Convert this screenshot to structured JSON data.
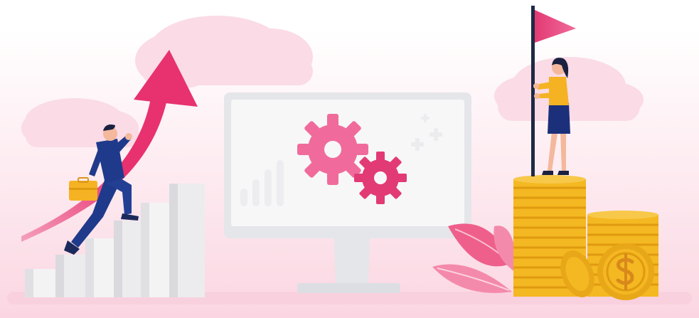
{
  "scene": {
    "description_free": true,
    "colors": {
      "accent_pink": "#e8316f",
      "light_pink": "#f7c6d6",
      "cloud_pink": "#f9dbe5",
      "gear_light": "#f06b9b",
      "gear_dark": "#e23a74",
      "monitor_frame": "#e4e6ea",
      "monitor_screen": "#f7f7f8",
      "bar_white": "#f3f3f4",
      "coin_gold": "#f4b822",
      "coin_dark": "#e09a10",
      "suit_navy": "#1f3a8a",
      "shirt_yellow": "#f5b324",
      "skirt_navy": "#1c2f7a",
      "leaf_pink": "#ef5f8c"
    },
    "icons": [
      "cloud-icon",
      "growth-arrow-icon",
      "businessman-icon",
      "briefcase-icon",
      "staircase-bars-icon",
      "monitor-icon",
      "gear-icon",
      "bar-chart-icon",
      "sparkle-plus-icon",
      "flag-icon",
      "businesswoman-icon",
      "coin-stack-icon",
      "dollar-coin-icon",
      "leaf-icon"
    ]
  }
}
